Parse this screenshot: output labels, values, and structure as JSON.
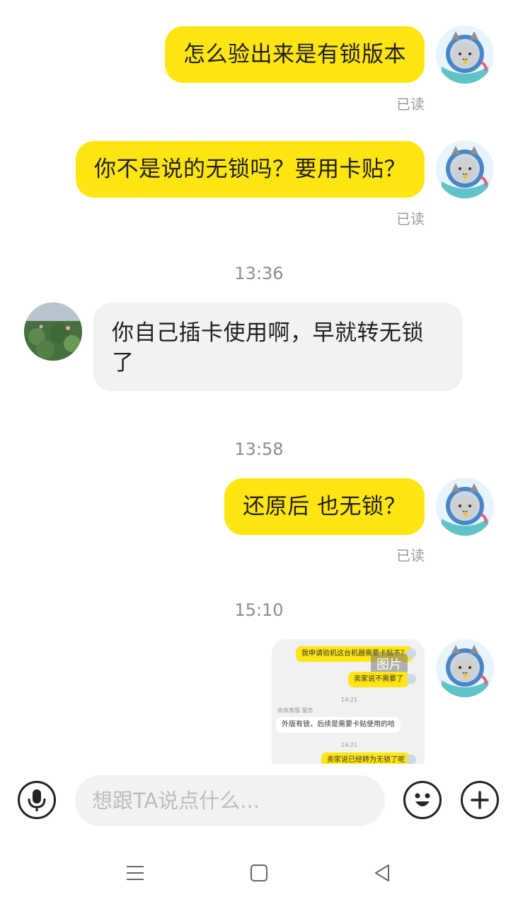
{
  "messages": [
    {
      "side": "me",
      "text": "怎么验出来是有锁版本",
      "status": "已读"
    },
    {
      "side": "me",
      "text": "你不是说的无锁吗？要用卡贴？",
      "status": "已读"
    },
    {
      "time": "13:36"
    },
    {
      "side": "other",
      "text": "你自己插卡使用啊，早就转无锁了"
    },
    {
      "time": "13:58"
    },
    {
      "side": "me",
      "text": "还原后 也无锁？",
      "status": "已读"
    },
    {
      "time": "15:10"
    },
    {
      "side": "me",
      "type": "image",
      "tag": "图片"
    }
  ],
  "image_preview": {
    "lines": [
      "我申请验机这台机器需要卡贴不？",
      "卖家说不需要了",
      "14:21",
      "收收客服  服务",
      "外版有锁，后续是需要卡贴使用的哈",
      "14:21",
      "卖家说已经转为无锁了呢"
    ]
  },
  "input": {
    "placeholder": "想跟TA说点什么..."
  },
  "icons": {
    "voice": "microphone-icon",
    "emoji": "smiley-icon",
    "plus": "plus-icon",
    "nav_menu": "menu-icon",
    "nav_home": "square-home-icon",
    "nav_back": "triangle-back-icon"
  },
  "colors": {
    "my_bubble": "#ffe512",
    "other_bubble": "#f2f2f2",
    "status_text": "#9a9a9a"
  }
}
